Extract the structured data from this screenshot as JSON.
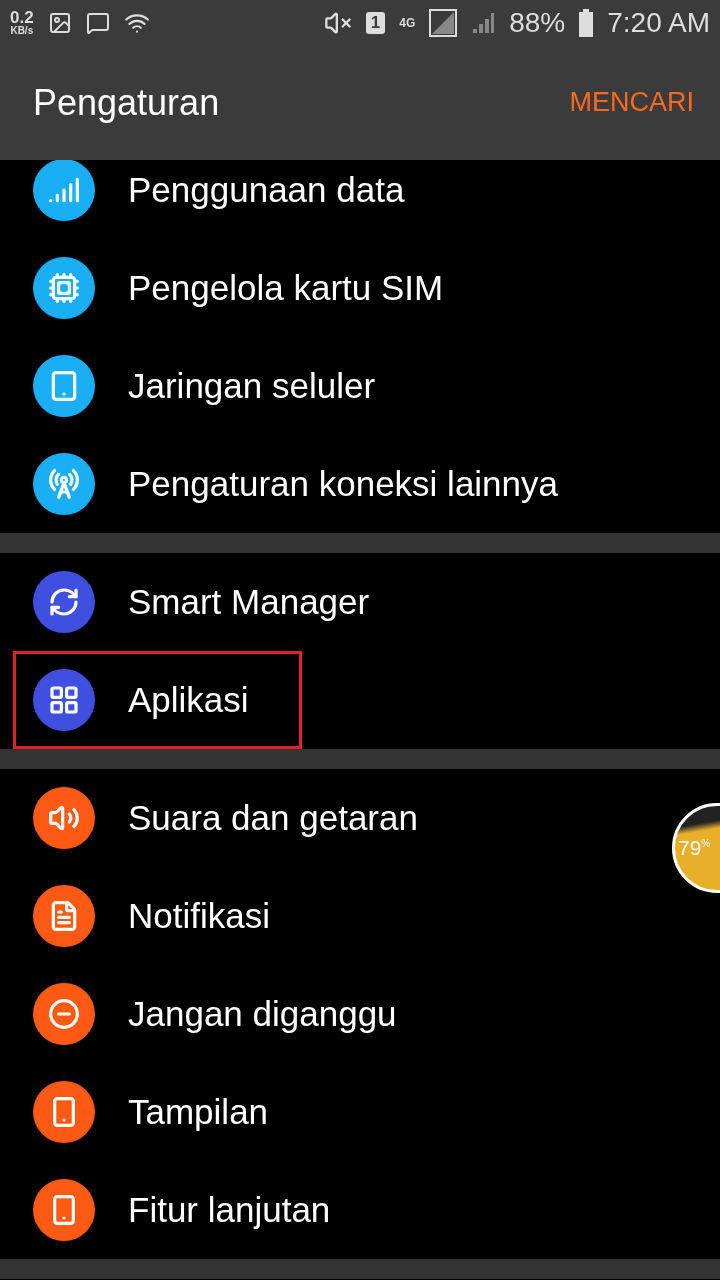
{
  "status_bar": {
    "speed": "0.2",
    "speed_unit": "KB/s",
    "sim_slot": "1",
    "network": "4G",
    "battery": "88%",
    "time": "7:20 AM"
  },
  "header": {
    "title": "Pengaturan",
    "action": "MENCARI"
  },
  "groups": [
    {
      "color": "#1aaff5",
      "items": [
        {
          "label": "Penggunaan data",
          "highlighted": false
        },
        {
          "label": "Pengelola kartu SIM",
          "highlighted": false
        },
        {
          "label": "Jaringan seluler",
          "highlighted": false
        },
        {
          "label": "Pengaturan koneksi lainnya",
          "highlighted": false
        }
      ]
    },
    {
      "color": "#3f4fe0",
      "items": [
        {
          "label": "Smart Manager",
          "highlighted": false
        },
        {
          "label": "Aplikasi",
          "highlighted": true
        }
      ]
    },
    {
      "color": "#ff5a14",
      "items": [
        {
          "label": "Suara dan getaran",
          "highlighted": false
        },
        {
          "label": "Notifikasi",
          "highlighted": false
        },
        {
          "label": "Jangan diganggu",
          "highlighted": false
        },
        {
          "label": "Tampilan",
          "highlighted": false
        },
        {
          "label": "Fitur lanjutan",
          "highlighted": false
        }
      ]
    }
  ],
  "floating_bubble": {
    "value": "79$^{%}$"
  }
}
